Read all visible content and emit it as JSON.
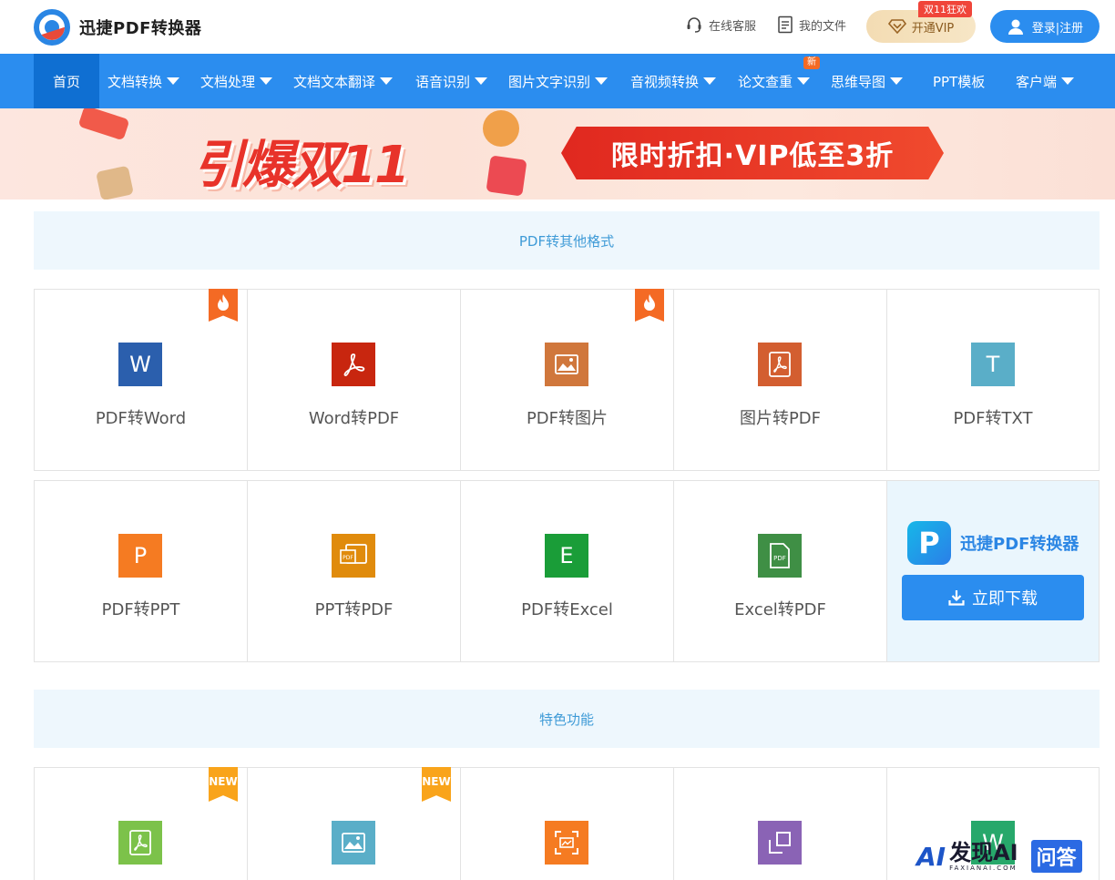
{
  "header": {
    "logo_text": "迅捷PDF转换器",
    "service_label": "在线客服",
    "files_label": "我的文件",
    "vip_label": "开通VIP",
    "vip_tag": "双11狂欢",
    "login_label": "登录|注册"
  },
  "nav": {
    "items": [
      {
        "label": "首页"
      },
      {
        "label": "文档转换"
      },
      {
        "label": "文档处理"
      },
      {
        "label": "文档文本翻译"
      },
      {
        "label": "语音识别"
      },
      {
        "label": "图片文字识别"
      },
      {
        "label": "音视频转换"
      },
      {
        "label": "论文查重"
      },
      {
        "label": "思维导图"
      },
      {
        "label": "PPT模板"
      },
      {
        "label": "客户端"
      }
    ],
    "new_badge": "新"
  },
  "banner": {
    "title": "引爆双11",
    "ribbon": "限时折扣·VIP低至3折"
  },
  "section1": {
    "title": "PDF转其他格式",
    "row1": [
      {
        "label": "PDF转Word",
        "icon": "word-icon",
        "glyph": "W",
        "color": "#2b5fad"
      },
      {
        "label": "Word转PDF",
        "icon": "pdf-icon",
        "color": "#c8260f"
      },
      {
        "label": "PDF转图片",
        "icon": "image-icon",
        "color": "#d0773c"
      },
      {
        "label": "图片转PDF",
        "icon": "pdf-icon",
        "color": "#d35e30"
      },
      {
        "label": "PDF转TXT",
        "icon": "txt-icon",
        "glyph": "T",
        "color": "#5aaec8"
      }
    ],
    "row2": [
      {
        "label": "PDF转PPT",
        "icon": "ppt-icon",
        "glyph": "P",
        "color": "#f57b22"
      },
      {
        "label": "PPT转PDF",
        "icon": "ppt-pdf-icon",
        "color": "#e08b0c"
      },
      {
        "label": "PDF转Excel",
        "icon": "excel-icon",
        "glyph": "E",
        "color": "#1a9d38"
      },
      {
        "label": "Excel转PDF",
        "icon": "excel-pdf-icon",
        "color": "#3f8f45"
      }
    ],
    "promo": {
      "logo_glyph": "P",
      "name": "迅捷PDF转换器",
      "download_label": "立即下载"
    }
  },
  "section2": {
    "title": "特色功能",
    "row": [
      {
        "icon": "pdf-icon",
        "color": "#7cc24a",
        "tag": "NEW"
      },
      {
        "icon": "image-icon",
        "color": "#5aaec8",
        "tag": "NEW"
      },
      {
        "icon": "scan-icon",
        "color": "#f57b22"
      },
      {
        "icon": "crop-icon",
        "color": "#8a63b5"
      },
      {
        "icon": "word-icon",
        "glyph": "W",
        "color": "#27a86b"
      }
    ]
  },
  "tags": {
    "hot": "hot-icon"
  },
  "watermark": {
    "mark": "AI",
    "main": "发现AI",
    "sub": "FAXIANAI.COM",
    "qa": "问答"
  }
}
